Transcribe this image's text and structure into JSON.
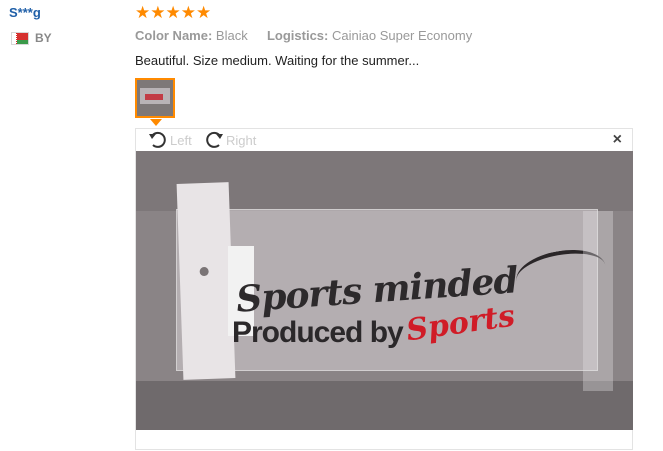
{
  "reviewer": {
    "name": "S***g",
    "country_code": "BY"
  },
  "rating": {
    "stars": 5,
    "max": 5,
    "star_color": "#ff8a00"
  },
  "attributes": {
    "color_label": "Color Name:",
    "color_value": "Black",
    "logistics_label": "Logistics:",
    "logistics_value": "Cainiao Super Economy"
  },
  "review_text": "Beautiful. Size medium. Waiting for the summer...",
  "viewer": {
    "rotate_left_label": "Left",
    "rotate_right_label": "Right",
    "close_label": "×"
  },
  "photo": {
    "text_black_script": "Sports minded",
    "text_black": "Produced by",
    "text_red": "Sports"
  },
  "colors": {
    "username": "#1f5fa8",
    "accent": "#ff8a00"
  }
}
